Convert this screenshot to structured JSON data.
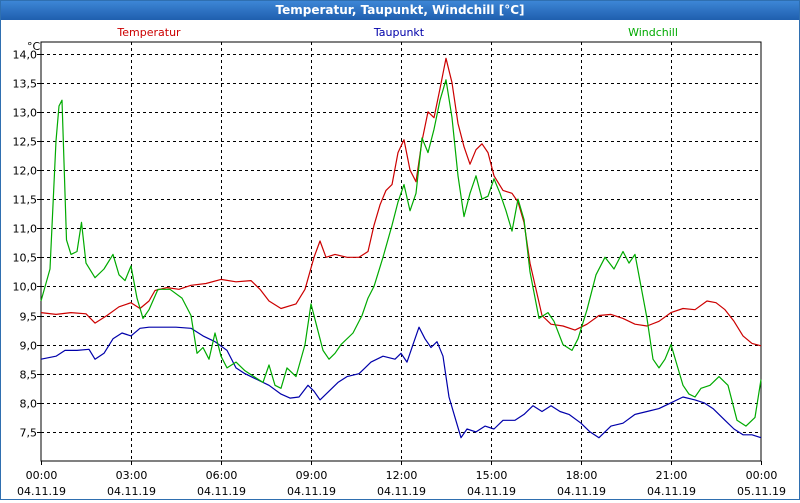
{
  "window": {
    "title": "Temperatur, Taupunkt, Windchill [°C]"
  },
  "chart_data": {
    "type": "line",
    "title": "Temperatur, Taupunkt, Windchill [°C]",
    "ylabel": "°C",
    "ylim": [
      7.0,
      14.2
    ],
    "yticks": [
      "14,0",
      "13,5",
      "13,0",
      "12,5",
      "12,0",
      "11,5",
      "11,0",
      "10,5",
      "10,0",
      "9,5",
      "9,0",
      "8,5",
      "8,0",
      "7,5"
    ],
    "ytick_values": [
      14.0,
      13.5,
      13.0,
      12.5,
      12.0,
      11.5,
      11.0,
      10.5,
      10.0,
      9.5,
      9.0,
      8.5,
      8.0,
      7.5
    ],
    "xlim_hours": [
      0,
      24
    ],
    "xticks": [
      {
        "hour": 0,
        "time": "00:00",
        "date": "04.11.19"
      },
      {
        "hour": 3,
        "time": "03:00",
        "date": "04.11.19"
      },
      {
        "hour": 6,
        "time": "06:00",
        "date": "04.11.19"
      },
      {
        "hour": 9,
        "time": "09:00",
        "date": "04.11.19"
      },
      {
        "hour": 12,
        "time": "12:00",
        "date": "04.11.19"
      },
      {
        "hour": 15,
        "time": "15:00",
        "date": "04.11.19"
      },
      {
        "hour": 18,
        "time": "18:00",
        "date": "04.11.19"
      },
      {
        "hour": 21,
        "time": "21:00",
        "date": "04.11.19"
      },
      {
        "hour": 24,
        "time": "00:00",
        "date": "05.11.19"
      }
    ],
    "grid": true,
    "legend_position": "top",
    "series": [
      {
        "name": "Temperatur",
        "color": "#cc0000",
        "points": [
          [
            0,
            9.55
          ],
          [
            0.5,
            9.52
          ],
          [
            1,
            9.55
          ],
          [
            1.5,
            9.53
          ],
          [
            1.8,
            9.37
          ],
          [
            2.2,
            9.5
          ],
          [
            2.6,
            9.65
          ],
          [
            3,
            9.72
          ],
          [
            3.3,
            9.62
          ],
          [
            3.6,
            9.75
          ],
          [
            3.8,
            9.93
          ],
          [
            4.2,
            9.98
          ],
          [
            4.6,
            9.95
          ],
          [
            5,
            10.02
          ],
          [
            5.5,
            10.05
          ],
          [
            6,
            10.12
          ],
          [
            6.5,
            10.08
          ],
          [
            7,
            10.1
          ],
          [
            7.3,
            9.95
          ],
          [
            7.6,
            9.75
          ],
          [
            8,
            9.62
          ],
          [
            8.5,
            9.7
          ],
          [
            8.8,
            9.95
          ],
          [
            9.1,
            10.5
          ],
          [
            9.3,
            10.78
          ],
          [
            9.5,
            10.5
          ],
          [
            9.8,
            10.55
          ],
          [
            10.2,
            10.5
          ],
          [
            10.6,
            10.5
          ],
          [
            10.9,
            10.6
          ],
          [
            11.1,
            11.05
          ],
          [
            11.3,
            11.4
          ],
          [
            11.5,
            11.65
          ],
          [
            11.7,
            11.75
          ],
          [
            11.9,
            12.3
          ],
          [
            12.1,
            12.52
          ],
          [
            12.3,
            12.0
          ],
          [
            12.5,
            11.8
          ],
          [
            12.7,
            12.5
          ],
          [
            12.9,
            13.0
          ],
          [
            13.1,
            12.9
          ],
          [
            13.3,
            13.4
          ],
          [
            13.5,
            13.92
          ],
          [
            13.7,
            13.5
          ],
          [
            13.9,
            12.8
          ],
          [
            14.1,
            12.4
          ],
          [
            14.3,
            12.1
          ],
          [
            14.5,
            12.35
          ],
          [
            14.7,
            12.45
          ],
          [
            14.9,
            12.3
          ],
          [
            15.1,
            11.9
          ],
          [
            15.4,
            11.65
          ],
          [
            15.7,
            11.6
          ],
          [
            15.9,
            11.45
          ],
          [
            16.1,
            11.1
          ],
          [
            16.3,
            10.4
          ],
          [
            16.5,
            9.95
          ],
          [
            16.7,
            9.5
          ],
          [
            17,
            9.35
          ],
          [
            17.4,
            9.32
          ],
          [
            17.8,
            9.25
          ],
          [
            18.2,
            9.35
          ],
          [
            18.6,
            9.5
          ],
          [
            19,
            9.52
          ],
          [
            19.4,
            9.45
          ],
          [
            19.8,
            9.35
          ],
          [
            20.2,
            9.32
          ],
          [
            20.6,
            9.4
          ],
          [
            21,
            9.55
          ],
          [
            21.4,
            9.62
          ],
          [
            21.8,
            9.6
          ],
          [
            22.2,
            9.75
          ],
          [
            22.5,
            9.72
          ],
          [
            22.8,
            9.6
          ],
          [
            23.1,
            9.4
          ],
          [
            23.4,
            9.15
          ],
          [
            23.7,
            9.02
          ],
          [
            24,
            8.98
          ]
        ]
      },
      {
        "name": "Taupunkt",
        "color": "#0000aa",
        "points": [
          [
            0,
            8.75
          ],
          [
            0.5,
            8.8
          ],
          [
            0.8,
            8.9
          ],
          [
            1.2,
            8.9
          ],
          [
            1.6,
            8.92
          ],
          [
            1.8,
            8.75
          ],
          [
            2.1,
            8.85
          ],
          [
            2.4,
            9.1
          ],
          [
            2.7,
            9.2
          ],
          [
            3,
            9.15
          ],
          [
            3.3,
            9.28
          ],
          [
            3.6,
            9.3
          ],
          [
            4,
            9.3
          ],
          [
            4.5,
            9.3
          ],
          [
            5,
            9.28
          ],
          [
            5.4,
            9.15
          ],
          [
            5.8,
            9.05
          ],
          [
            6.2,
            8.9
          ],
          [
            6.5,
            8.6
          ],
          [
            6.8,
            8.5
          ],
          [
            7.2,
            8.4
          ],
          [
            7.6,
            8.3
          ],
          [
            8,
            8.15
          ],
          [
            8.3,
            8.08
          ],
          [
            8.6,
            8.1
          ],
          [
            8.9,
            8.3
          ],
          [
            9.1,
            8.2
          ],
          [
            9.3,
            8.05
          ],
          [
            9.6,
            8.2
          ],
          [
            9.9,
            8.35
          ],
          [
            10.2,
            8.45
          ],
          [
            10.6,
            8.5
          ],
          [
            10.8,
            8.6
          ],
          [
            11,
            8.7
          ],
          [
            11.4,
            8.8
          ],
          [
            11.8,
            8.75
          ],
          [
            12,
            8.85
          ],
          [
            12.2,
            8.7
          ],
          [
            12.4,
            9.0
          ],
          [
            12.6,
            9.3
          ],
          [
            12.8,
            9.1
          ],
          [
            13,
            8.95
          ],
          [
            13.2,
            9.05
          ],
          [
            13.4,
            8.8
          ],
          [
            13.6,
            8.1
          ],
          [
            13.8,
            7.75
          ],
          [
            14,
            7.4
          ],
          [
            14.2,
            7.55
          ],
          [
            14.5,
            7.5
          ],
          [
            14.8,
            7.6
          ],
          [
            15.1,
            7.55
          ],
          [
            15.4,
            7.7
          ],
          [
            15.8,
            7.7
          ],
          [
            16.1,
            7.8
          ],
          [
            16.4,
            7.95
          ],
          [
            16.7,
            7.85
          ],
          [
            17,
            7.95
          ],
          [
            17.3,
            7.85
          ],
          [
            17.6,
            7.8
          ],
          [
            18,
            7.65
          ],
          [
            18.3,
            7.5
          ],
          [
            18.6,
            7.4
          ],
          [
            19,
            7.6
          ],
          [
            19.4,
            7.65
          ],
          [
            19.8,
            7.8
          ],
          [
            20.2,
            7.85
          ],
          [
            20.6,
            7.9
          ],
          [
            21,
            8.0
          ],
          [
            21.4,
            8.1
          ],
          [
            21.8,
            8.05
          ],
          [
            22.1,
            8.0
          ],
          [
            22.4,
            7.9
          ],
          [
            22.8,
            7.7
          ],
          [
            23.1,
            7.55
          ],
          [
            23.4,
            7.45
          ],
          [
            23.7,
            7.45
          ],
          [
            24,
            7.4
          ]
        ]
      },
      {
        "name": "Windchill",
        "color": "#00aa00",
        "points": [
          [
            0,
            9.75
          ],
          [
            0.3,
            10.3
          ],
          [
            0.5,
            12.5
          ],
          [
            0.6,
            13.1
          ],
          [
            0.7,
            13.2
          ],
          [
            0.85,
            10.8
          ],
          [
            1.0,
            10.55
          ],
          [
            1.2,
            10.6
          ],
          [
            1.35,
            11.1
          ],
          [
            1.5,
            10.4
          ],
          [
            1.8,
            10.15
          ],
          [
            2.1,
            10.3
          ],
          [
            2.4,
            10.55
          ],
          [
            2.6,
            10.2
          ],
          [
            2.8,
            10.1
          ],
          [
            3.0,
            10.35
          ],
          [
            3.2,
            9.8
          ],
          [
            3.4,
            9.45
          ],
          [
            3.6,
            9.6
          ],
          [
            3.9,
            9.95
          ],
          [
            4.3,
            9.95
          ],
          [
            4.7,
            9.8
          ],
          [
            5.0,
            9.5
          ],
          [
            5.2,
            8.85
          ],
          [
            5.4,
            8.95
          ],
          [
            5.6,
            8.75
          ],
          [
            5.8,
            9.2
          ],
          [
            6.0,
            8.8
          ],
          [
            6.2,
            8.6
          ],
          [
            6.5,
            8.7
          ],
          [
            6.8,
            8.55
          ],
          [
            7.1,
            8.45
          ],
          [
            7.4,
            8.35
          ],
          [
            7.6,
            8.65
          ],
          [
            7.8,
            8.3
          ],
          [
            8.0,
            8.25
          ],
          [
            8.2,
            8.6
          ],
          [
            8.5,
            8.45
          ],
          [
            8.8,
            9.0
          ],
          [
            9.0,
            9.7
          ],
          [
            9.2,
            9.3
          ],
          [
            9.4,
            8.9
          ],
          [
            9.6,
            8.75
          ],
          [
            9.8,
            8.85
          ],
          [
            10.0,
            9.0
          ],
          [
            10.4,
            9.2
          ],
          [
            10.7,
            9.5
          ],
          [
            10.9,
            9.8
          ],
          [
            11.1,
            10.0
          ],
          [
            11.4,
            10.5
          ],
          [
            11.7,
            11.05
          ],
          [
            11.9,
            11.45
          ],
          [
            12.1,
            11.75
          ],
          [
            12.3,
            11.3
          ],
          [
            12.5,
            11.6
          ],
          [
            12.7,
            12.55
          ],
          [
            12.9,
            12.3
          ],
          [
            13.1,
            12.7
          ],
          [
            13.3,
            13.2
          ],
          [
            13.5,
            13.55
          ],
          [
            13.7,
            12.9
          ],
          [
            13.9,
            11.9
          ],
          [
            14.1,
            11.2
          ],
          [
            14.3,
            11.6
          ],
          [
            14.5,
            11.9
          ],
          [
            14.7,
            11.5
          ],
          [
            14.9,
            11.55
          ],
          [
            15.1,
            11.85
          ],
          [
            15.3,
            11.6
          ],
          [
            15.5,
            11.3
          ],
          [
            15.7,
            10.95
          ],
          [
            15.9,
            11.5
          ],
          [
            16.1,
            11.15
          ],
          [
            16.3,
            10.25
          ],
          [
            16.6,
            9.45
          ],
          [
            16.9,
            9.55
          ],
          [
            17.1,
            9.4
          ],
          [
            17.4,
            9.0
          ],
          [
            17.7,
            8.9
          ],
          [
            17.9,
            9.1
          ],
          [
            18.2,
            9.6
          ],
          [
            18.5,
            10.2
          ],
          [
            18.8,
            10.5
          ],
          [
            19.1,
            10.3
          ],
          [
            19.4,
            10.6
          ],
          [
            19.6,
            10.4
          ],
          [
            19.8,
            10.55
          ],
          [
            20.0,
            10.0
          ],
          [
            20.2,
            9.45
          ],
          [
            20.4,
            8.75
          ],
          [
            20.6,
            8.6
          ],
          [
            20.8,
            8.75
          ],
          [
            21.0,
            9.0
          ],
          [
            21.2,
            8.65
          ],
          [
            21.4,
            8.3
          ],
          [
            21.6,
            8.15
          ],
          [
            21.8,
            8.1
          ],
          [
            22.0,
            8.25
          ],
          [
            22.3,
            8.3
          ],
          [
            22.6,
            8.45
          ],
          [
            22.9,
            8.3
          ],
          [
            23.2,
            7.7
          ],
          [
            23.5,
            7.6
          ],
          [
            23.8,
            7.75
          ],
          [
            24,
            8.4
          ]
        ]
      }
    ]
  }
}
